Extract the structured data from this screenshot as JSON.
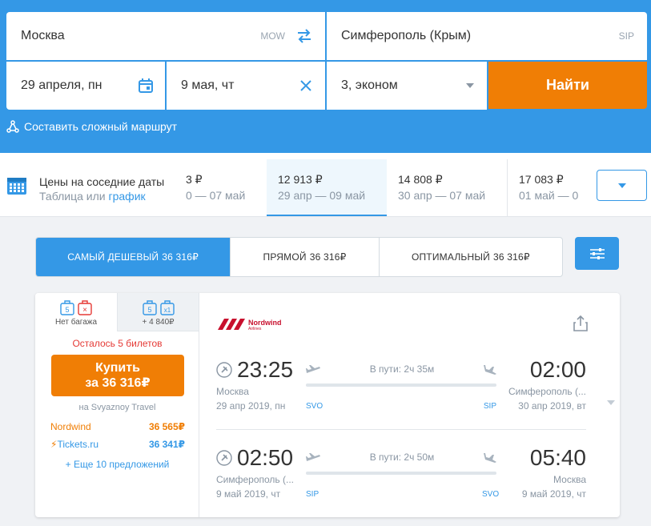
{
  "search": {
    "origin": {
      "city": "Москва",
      "iata": "MOW"
    },
    "destination": {
      "city": "Симферополь (Крым)",
      "iata": "SIP"
    },
    "depart_date": "29 апреля, пн",
    "return_date": "9 мая, чт",
    "passengers": "3, эконом",
    "find_label": "Найти",
    "complex_route_label": "Составить сложный маршрут",
    "colors": {
      "panel": "#3498e6",
      "accent": "#f07e05"
    }
  },
  "nearby": {
    "title": "Цены на соседние даты",
    "sub_table": "Таблица",
    "sub_or": "или",
    "sub_chart": "график",
    "cells": [
      {
        "price": "3 ₽",
        "range": "0 — 07 май"
      },
      {
        "price": "12 913 ₽",
        "range": "29 апр — 09 май"
      },
      {
        "price": "14 808 ₽",
        "range": "30 апр — 07 май"
      },
      {
        "price": "17 083 ₽",
        "range": "01 май — 0"
      }
    ]
  },
  "sort": {
    "tabs": [
      {
        "label": "Самый дешевый",
        "price": "36 316₽"
      },
      {
        "label": "Прямой",
        "price": "36 316₽"
      },
      {
        "label": "Оптимальный",
        "price": "36 316₽"
      }
    ]
  },
  "ticket": {
    "baggage": [
      {
        "label": "Нет багажа",
        "hand": "5",
        "bag": "×"
      },
      {
        "label": "+ 4 840₽",
        "hand": "5",
        "bag": "x1"
      }
    ],
    "remaining": "Осталось 5 билетов",
    "buy_line1": "Купить",
    "buy_line2": "за 36 316₽",
    "via": "на Svyaznoy Travel",
    "offers": [
      {
        "agency": "Nordwind",
        "price": "36 565₽"
      },
      {
        "agency": "Tickets.ru",
        "price": "36 341₽"
      }
    ],
    "more_offers": "+ Еще 10 предложений",
    "airline": "Nordwind",
    "airline_sub": "Airlines",
    "segments": [
      {
        "dep_time": "23:25",
        "dep_city": "Москва",
        "dep_date": "29 апр 2019, пн",
        "duration": "В пути: 2ч 35м",
        "from_iata": "SVO",
        "to_iata": "SIP",
        "arr_time": "02:00",
        "arr_city": "Симферополь (...",
        "arr_date": "30 апр 2019, вт"
      },
      {
        "dep_time": "02:50",
        "dep_city": "Симферополь (...",
        "dep_date": "9 май 2019, чт",
        "duration": "В пути: 2ч 50м",
        "from_iata": "SIP",
        "to_iata": "SVO",
        "arr_time": "05:40",
        "arr_city": "Москва",
        "arr_date": "9 май 2019, чт"
      }
    ]
  }
}
